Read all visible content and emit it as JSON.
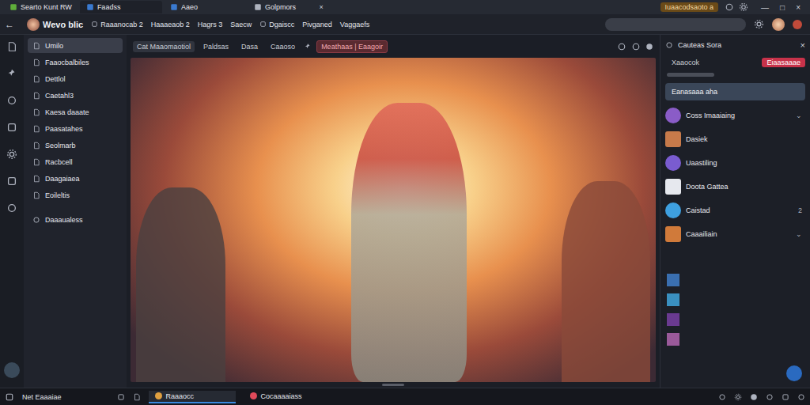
{
  "browser_tabs": [
    {
      "label": "Searto Kunt RW",
      "selected": false
    },
    {
      "label": "Faadss",
      "selected": true
    },
    {
      "label": "Aaeo",
      "selected": false
    },
    {
      "label": "Golpmors",
      "selected": false,
      "close": "×"
    }
  ],
  "top_badge": "Iuaacodsaoto a",
  "window_controls": [
    "—",
    "□",
    "×"
  ],
  "nav": {
    "back": "←",
    "app_name": "Wevo blic",
    "menus": [
      "Raaanocab 2",
      "Haaaeaob 2",
      "Hagrs 3",
      "Saecw",
      "Dgaiscc",
      "Pivganed",
      "Vaggaefs"
    ]
  },
  "sidebar": {
    "items": [
      {
        "label": "Umilo",
        "selected": true
      },
      {
        "label": "Faaocbalbiles",
        "selected": false
      },
      {
        "label": "Dettlol",
        "selected": false
      },
      {
        "label": "Caetahl3",
        "selected": false
      },
      {
        "label": "Kaesa daaate",
        "selected": false
      },
      {
        "label": "Paasatahes",
        "selected": false
      },
      {
        "label": "Seolmarb",
        "selected": false
      },
      {
        "label": "Racbcell",
        "selected": false
      },
      {
        "label": "Daagaiaea",
        "selected": false
      },
      {
        "label": "Eoileltis",
        "selected": false
      }
    ],
    "footer": "Daaaualess"
  },
  "toolbar": {
    "buttons": [
      "Cat Maaomaotiol",
      "Paldsas",
      "Dasa",
      "Caaoso"
    ],
    "alert": "Meathaas | Eaagoir"
  },
  "panel": {
    "title": "Cauteas Sora",
    "close": "×",
    "subtitle": "Xaaocok",
    "badge": "Eiaasaaae",
    "selected_item": "Eanasaaa aha",
    "items": [
      {
        "label": "Coss Imaaiaing",
        "suffix": "⌄",
        "color": "#8a5cc7"
      },
      {
        "label": "Dasiek",
        "suffix": "",
        "color": "#c77a4a"
      },
      {
        "label": "Uaastiling",
        "suffix": "",
        "color": "#7a5cd0"
      },
      {
        "label": "Doota Gattea",
        "suffix": "",
        "color": "#e6e8ee"
      },
      {
        "label": "Caistad",
        "suffix": "2",
        "color": "#3ea0e0"
      },
      {
        "label": "Caaailiain",
        "suffix": "⌄",
        "color": "#d07a3a"
      }
    ],
    "swatches": [
      {
        "color": "#3a6fb0"
      },
      {
        "color": "#3a90c0"
      },
      {
        "color": "#6a3a90"
      },
      {
        "color": "#9a5a9a"
      }
    ]
  },
  "status_bar": {
    "back": "Net Eaaaiae",
    "tabs": [
      {
        "label": "Raaaocc",
        "selected": true
      },
      {
        "label": "Cocaaaaiass",
        "selected": false
      }
    ]
  }
}
